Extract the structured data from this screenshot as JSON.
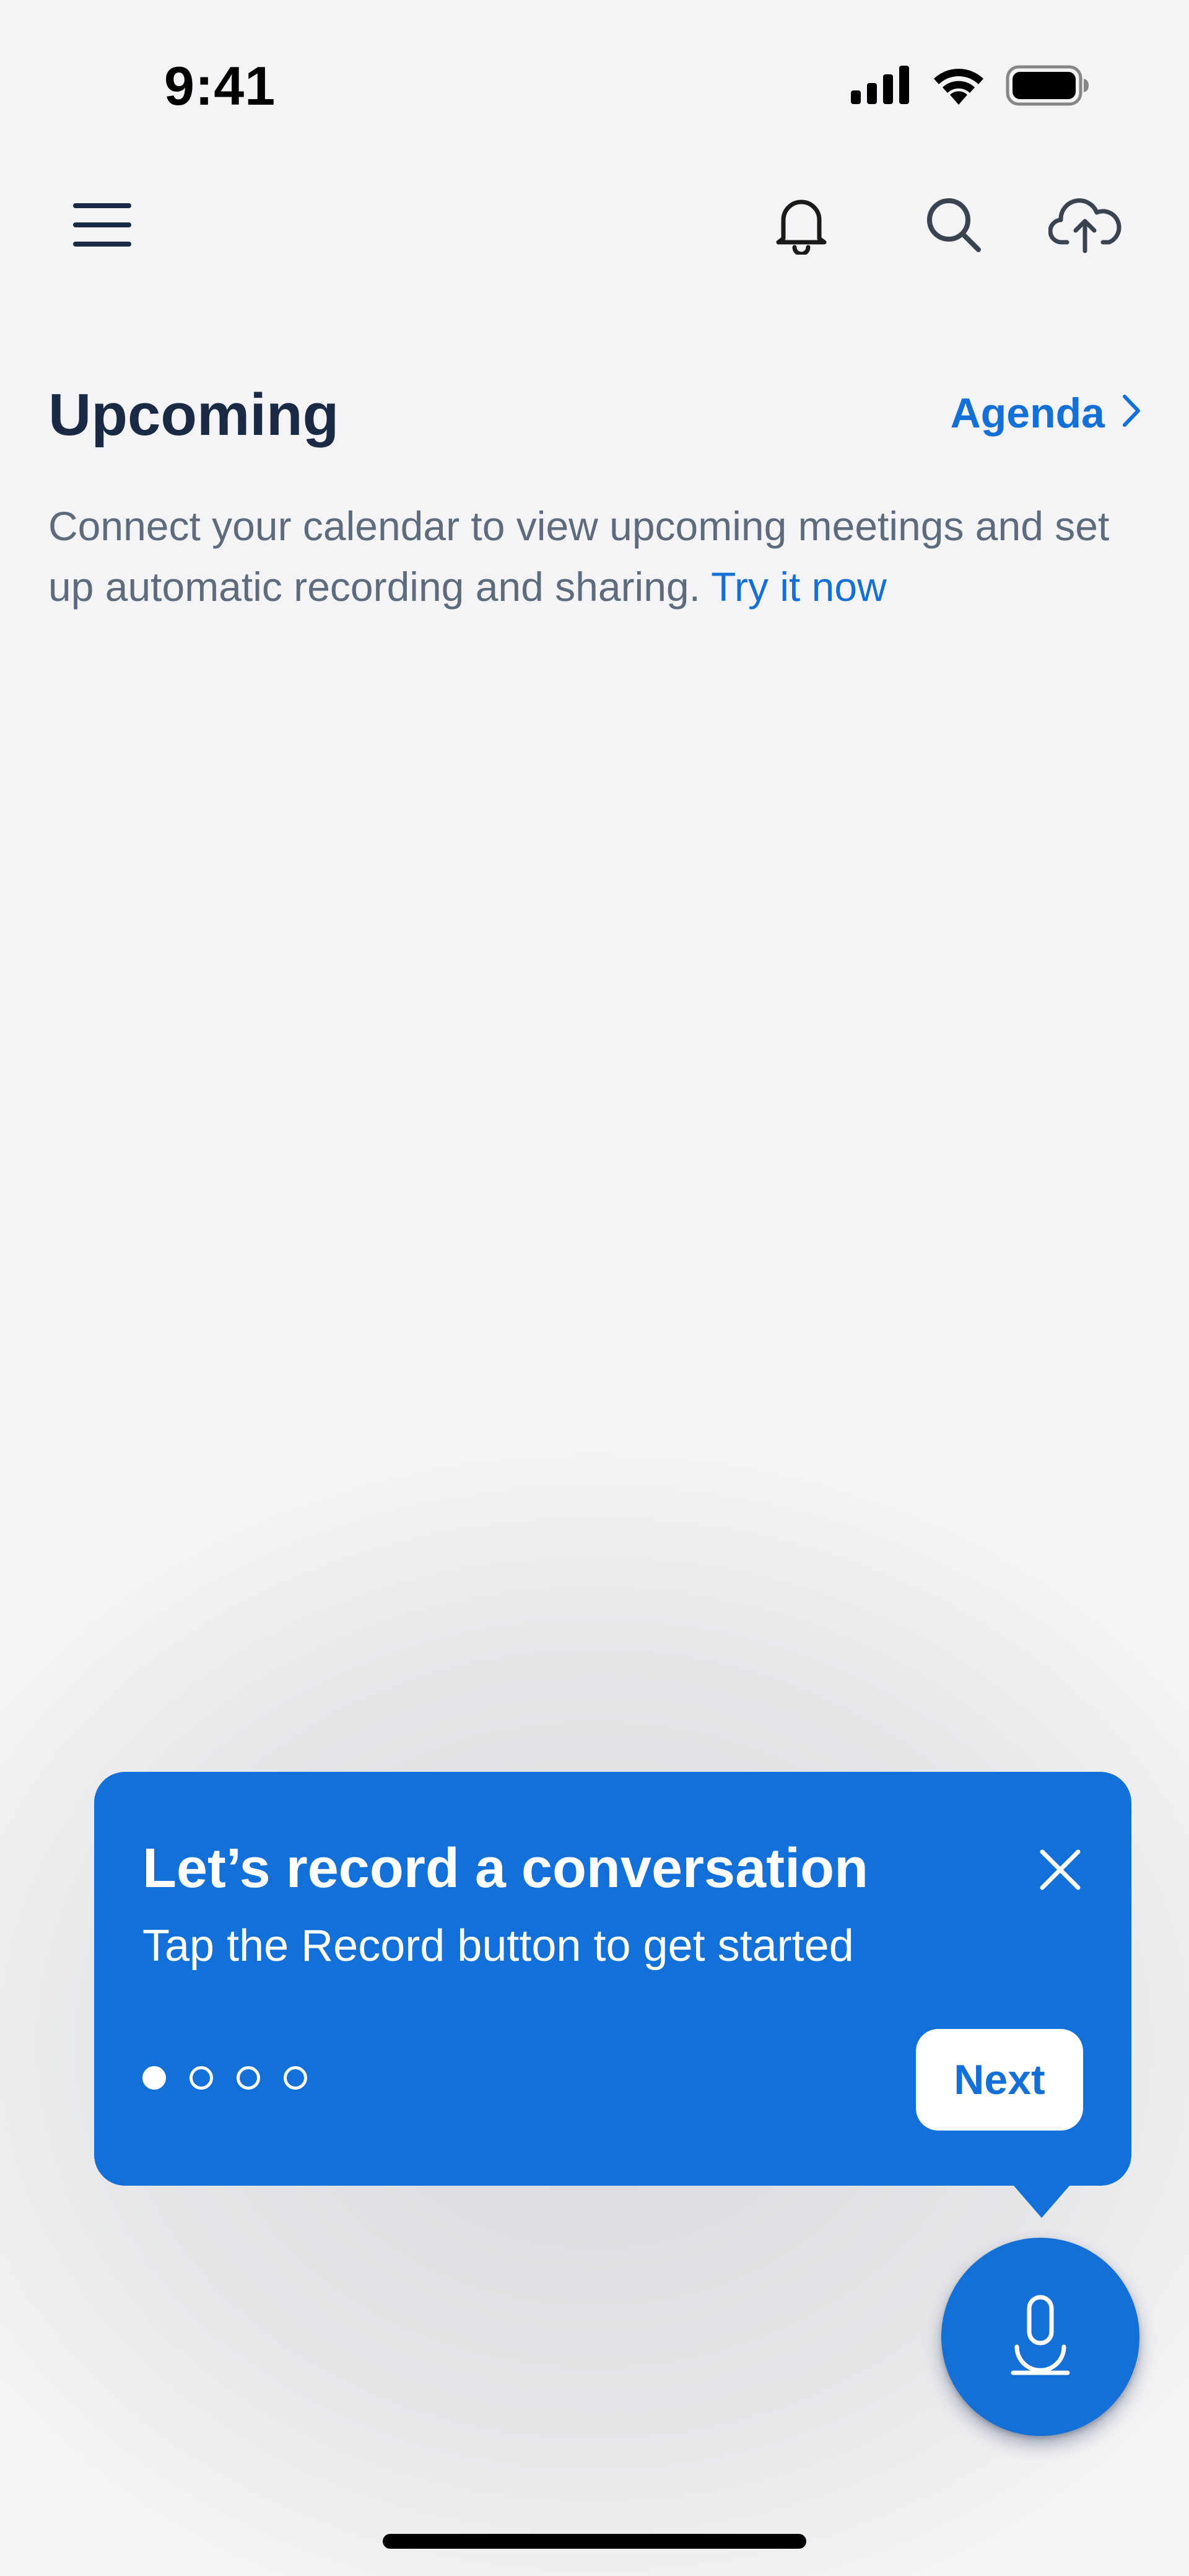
{
  "status_bar": {
    "time": "9:41",
    "icons": [
      "cellular-signal-icon",
      "wifi-icon",
      "battery-icon"
    ]
  },
  "top_nav": {
    "icons": [
      "hamburger-menu-icon",
      "bell-icon",
      "search-icon",
      "cloud-upload-icon"
    ]
  },
  "upcoming": {
    "title": "Upcoming",
    "agenda_label": "Agenda",
    "description": "Connect your calendar to view upcoming meetings and set up automatic recording and sharing.",
    "try_link": "Try it now"
  },
  "tooltip": {
    "title": "Let’s record a conversation",
    "subtitle": "Tap the Record button to get started",
    "next_label": "Next",
    "step_current": 1,
    "step_total": 4
  },
  "record_button": {
    "icon": "microphone-icon"
  },
  "colors": {
    "accent": "#1470d6",
    "title": "#1a2a44",
    "body_text": "#5d6b7d",
    "background": "#f4f4f6"
  }
}
